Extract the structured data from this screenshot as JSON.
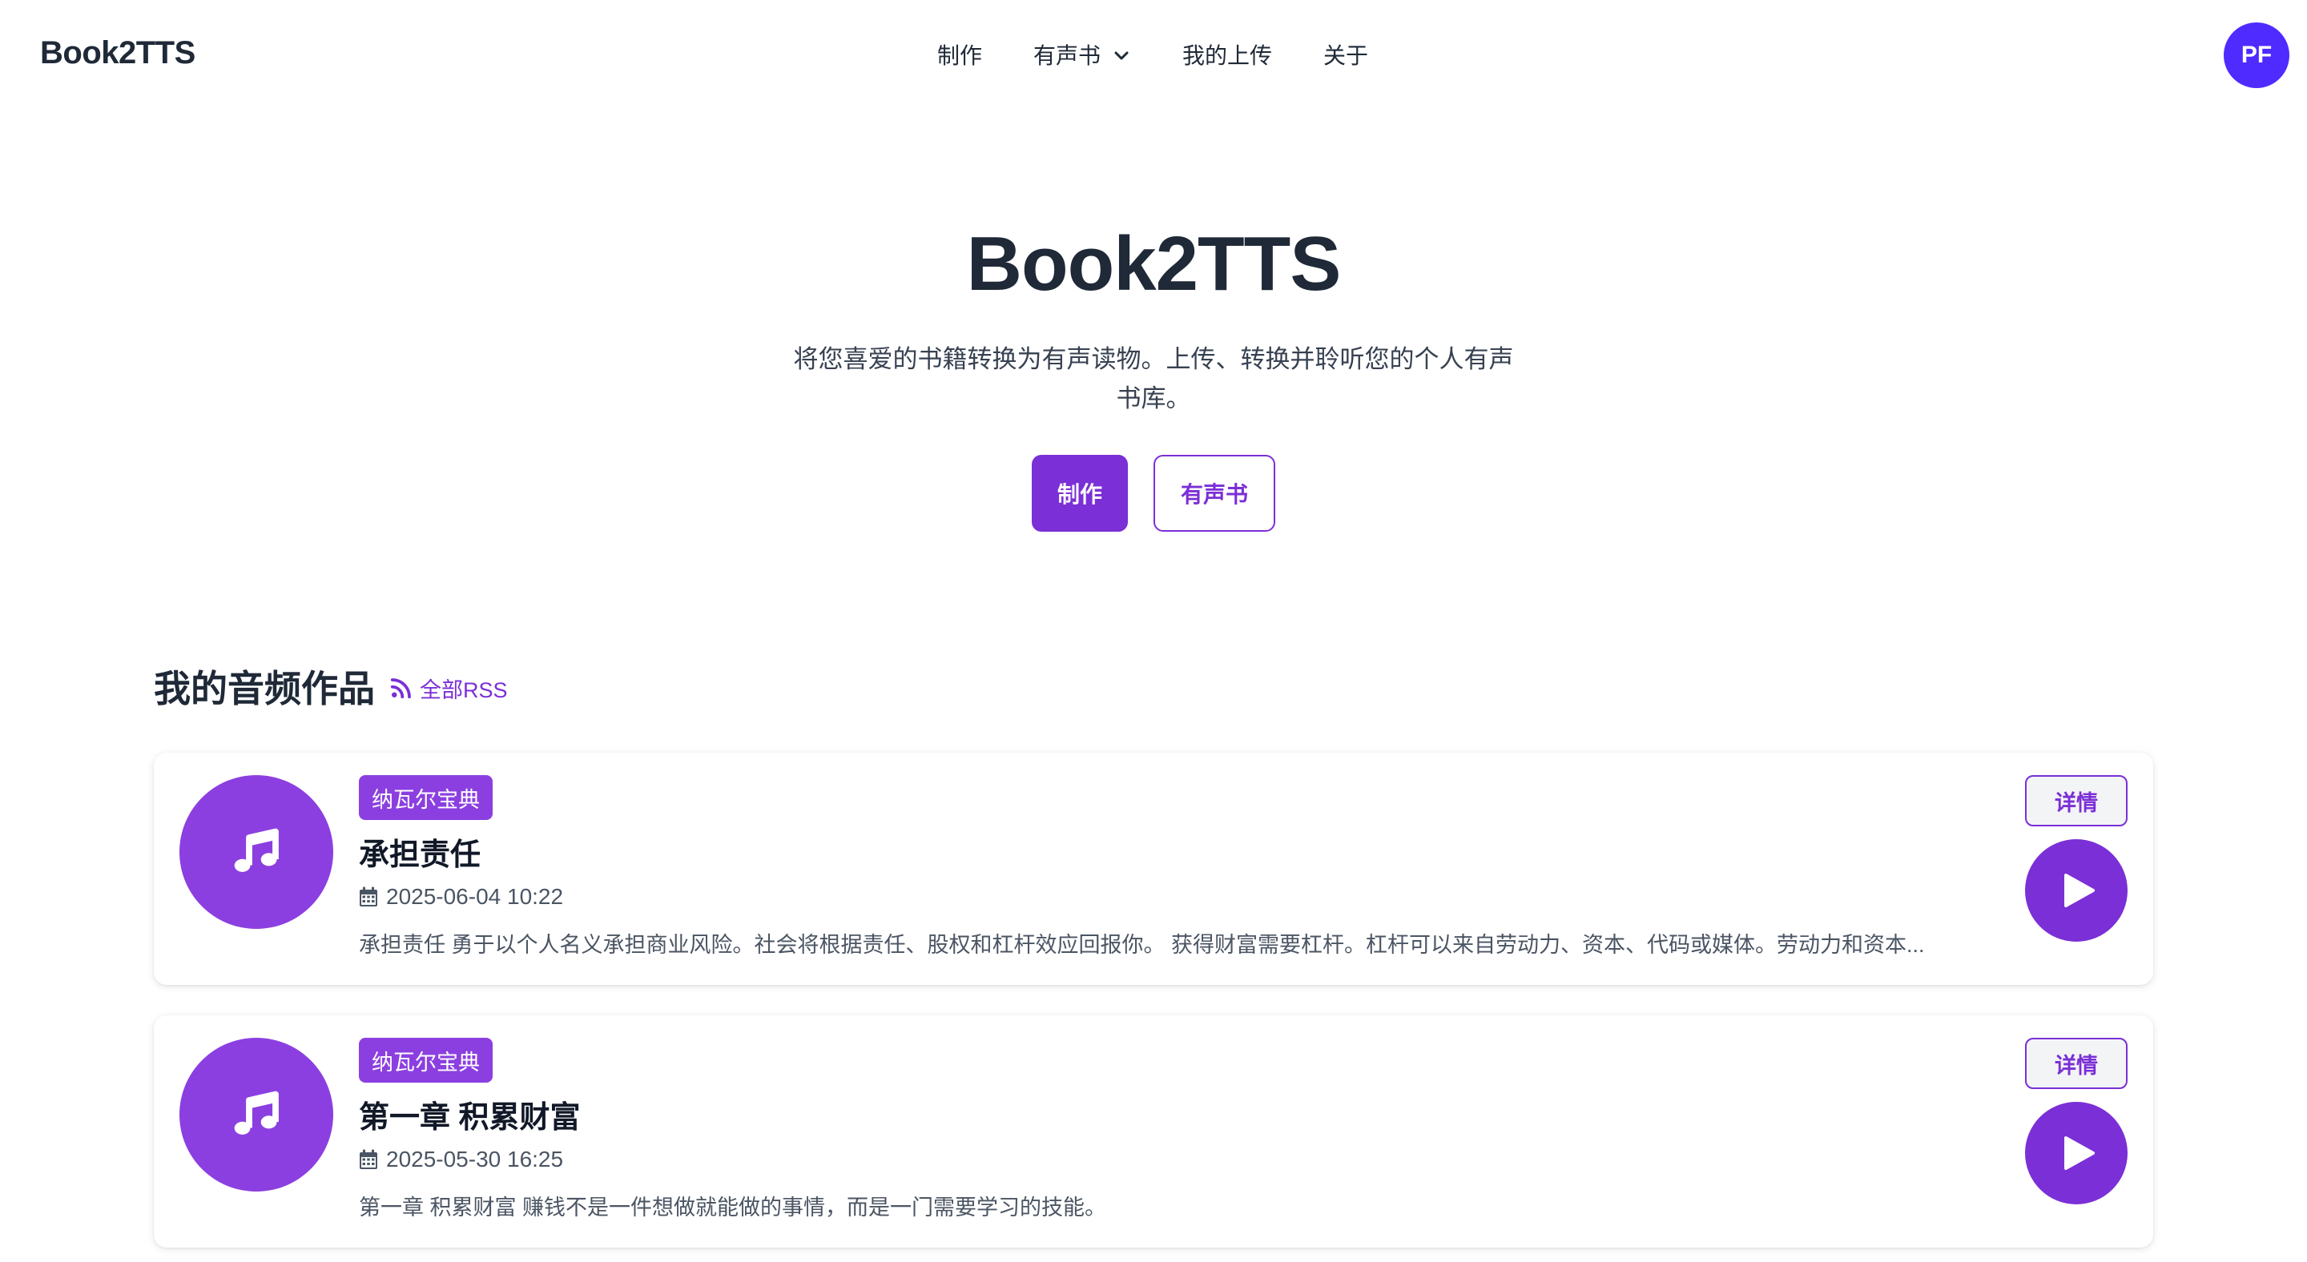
{
  "header": {
    "brand": "Book2TTS",
    "nav": [
      {
        "label": "制作"
      },
      {
        "label": "有声书"
      },
      {
        "label": "我的上传"
      },
      {
        "label": "关于"
      }
    ],
    "avatar_initials": "PF"
  },
  "hero": {
    "title": "Book2TTS",
    "subtitle": "将您喜爱的书籍转换为有声读物。上传、转换并聆听您的个人有声书库。",
    "primary_button": "制作",
    "secondary_button": "有声书"
  },
  "section": {
    "title": "我的音频作品",
    "rss_label": "全部RSS"
  },
  "works": [
    {
      "badge": "纳瓦尔宝典",
      "title": "承担责任",
      "date": "2025-06-04 10:22",
      "excerpt": "承担责任 勇于以个人名义承担商业风险。社会将根据责任、股权和杠杆效应回报你。 获得财富需要杠杆。杠杆可以来自劳动力、资本、代码或媒体。劳动力和资本...",
      "detail_label": "详情"
    },
    {
      "badge": "纳瓦尔宝典",
      "title": "第一章 积累财富",
      "date": "2025-05-30 16:25",
      "excerpt": "第一章 积累财富 赚钱不是一件想做就能做的事情，而是一门需要学习的技能。",
      "detail_label": "详情"
    }
  ],
  "colors": {
    "accent": "#7b2fd6",
    "badge": "#8b3fe0",
    "avatar": "#4f2bff",
    "text": "#1f2937"
  },
  "icons": {
    "nav_dropdown": "chevron-down-icon",
    "rss": "rss-icon",
    "work_cover": "music-note-icon",
    "date": "calendar-icon",
    "play": "play-icon"
  }
}
